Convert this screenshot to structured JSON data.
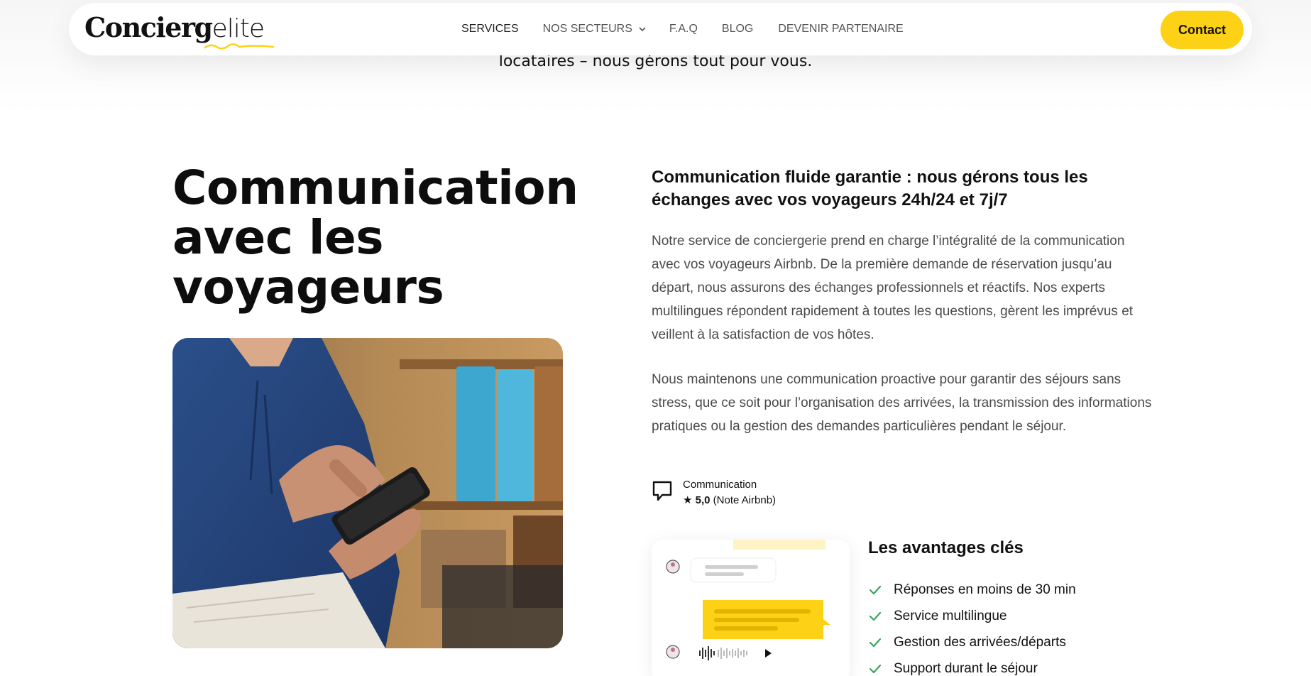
{
  "page": {
    "above_text": "locataires – nous gérons tout pour vous."
  },
  "header": {
    "logo_main": "Concierg",
    "logo_sub": "elite",
    "nav": [
      {
        "label": "SERVICES",
        "active": true
      },
      {
        "label": "NOS SECTEURS",
        "has_dropdown": true
      },
      {
        "label": "F.A.Q"
      },
      {
        "label": "BLOG"
      },
      {
        "label": "DEVENIR PARTENAIRE"
      }
    ],
    "contact_label": "Contact",
    "accent_color": "#fcd116"
  },
  "section": {
    "title": "Communication avec les voyageurs",
    "subheading": "Communication fluide garantie : nous gérons tous les échanges avec vos voyageurs 24h/24 et 7j/7",
    "paragraph_1": "Notre service de conciergerie prend en charge l’intégralité de la communication avec vos voyageurs Airbnb. De la première demande de réservation jusqu’au départ, nous assurons des échanges professionnels et réactifs. Nos experts multilingues répondent rapidement à toutes les questions, gèrent les imprévus et veillent à la satisfaction de vos hôtes.",
    "paragraph_2": "Nous maintenons une communication proactive pour garantir des séjours sans stress, que ce soit pour l’organisation des arrivées, la transmission des informations pratiques ou la gestion des demandes particulières pendant le séjour.",
    "rating": {
      "label": "Communication",
      "star": "★",
      "score": "5,0",
      "note": "(Note Airbnb)"
    },
    "advantages": {
      "title": "Les avantages clés",
      "items": [
        "Réponses en moins de 30 min",
        "Service multilingue",
        "Gestion des arrivées/départs",
        "Support durant le séjour"
      ],
      "check_color": "#3aa35a"
    }
  }
}
